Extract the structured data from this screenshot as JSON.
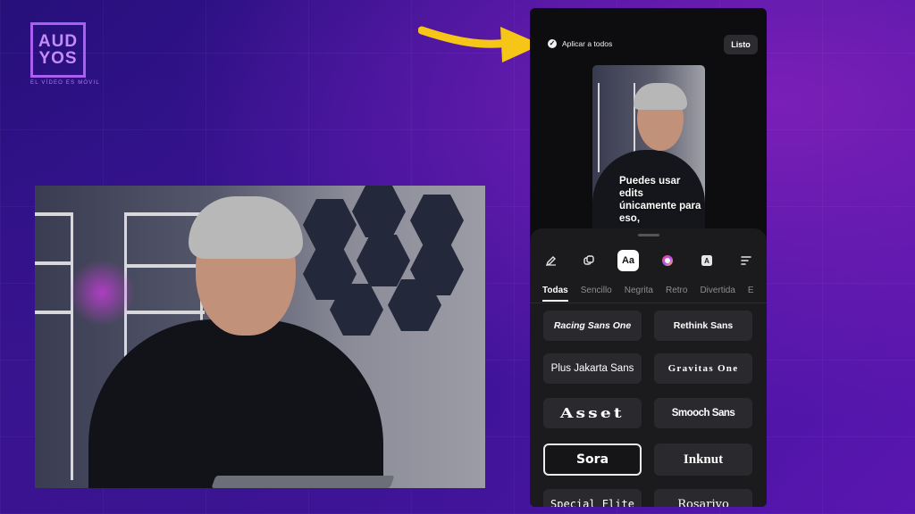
{
  "logo": {
    "line1": "AUD",
    "line2": "YOS",
    "tagline": "EL VÍDEO ES MÓVIL"
  },
  "phone": {
    "apply_all_label": "Aplicar a todos",
    "done_label": "Listo",
    "preview_caption": "Puedes usar edits únicamente para eso,",
    "toolbar": [
      {
        "name": "pen-icon"
      },
      {
        "name": "layers-icon"
      },
      {
        "name": "text-style-icon",
        "label": "Aa"
      },
      {
        "name": "color-wheel-icon"
      },
      {
        "name": "text-background-icon",
        "label": "A"
      },
      {
        "name": "align-icon"
      }
    ],
    "tabs": [
      "Todas",
      "Sencillo",
      "Negrita",
      "Retro",
      "Divertida",
      "E"
    ],
    "active_tab": "Todas",
    "fonts": [
      "Racing Sans One",
      "Rethink Sans",
      "Plus Jakarta Sans",
      "Gravitas One",
      "Asset",
      "Smooch Sans",
      "Sora",
      "Inknut",
      "Special Elite",
      "Rosarivo"
    ],
    "selected_font": "Sora"
  },
  "colors": {
    "arrow": "#f5c518",
    "accent_purple": "#a95ff0",
    "phone_bg": "#0d0d0f",
    "sheet_bg": "#1b1b1e",
    "chip_bg": "#2a2a2e"
  }
}
